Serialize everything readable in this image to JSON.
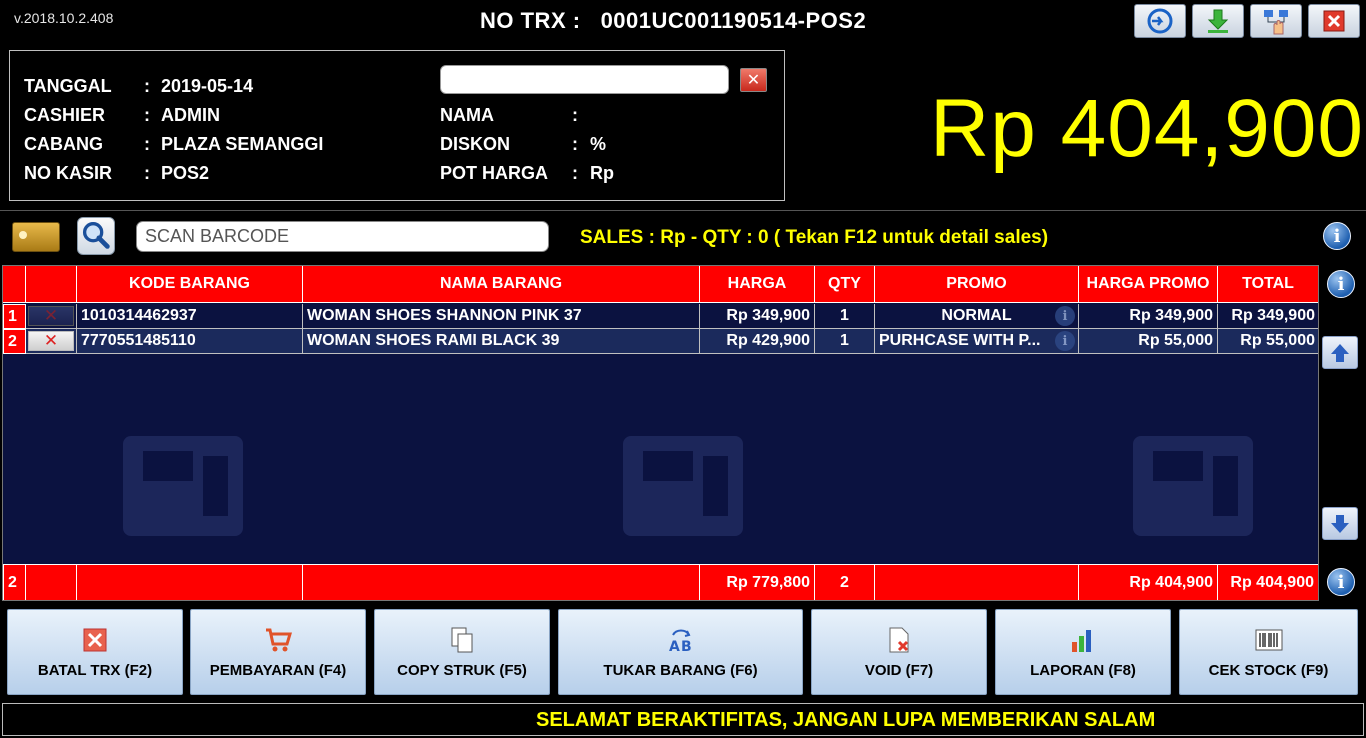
{
  "header": {
    "version": "v.2018.10.2.408",
    "trx_label": "NO TRX :",
    "trx_value": "0001UC001190514-POS2"
  },
  "toolbar": [
    {
      "name": "refresh",
      "icon": "refresh-icon"
    },
    {
      "name": "download",
      "icon": "download-icon"
    },
    {
      "name": "network",
      "icon": "network-hand-icon"
    },
    {
      "name": "close",
      "icon": "close-icon"
    }
  ],
  "info": {
    "tanggal_label": "TANGGAL",
    "tanggal_value": "2019-05-14",
    "cashier_label": "CASHIER",
    "cashier_value": "ADMIN",
    "cabang_label": "CABANG",
    "cabang_value": "PLAZA SEMANGGI",
    "kasir_label": "NO KASIR",
    "kasir_value": "POS2",
    "nama_label": "NAMA",
    "nama_value": "",
    "diskon_label": "DISKON",
    "diskon_value": "%",
    "pot_label": "POT HARGA",
    "pot_value": "Rp",
    "colon": ":",
    "member_value": ""
  },
  "total": "Rp 404,900",
  "scan": {
    "placeholder": "SCAN BARCODE",
    "sales_info": "SALES : Rp  - QTY : 0 ( Tekan F12 untuk detail sales)"
  },
  "grid": {
    "columns": [
      "",
      "",
      "KODE BARANG",
      "NAMA BARANG",
      "HARGA",
      "QTY",
      "PROMO",
      "HARGA PROMO",
      "TOTAL"
    ],
    "rows": [
      {
        "no": "1",
        "kode": "1010314462937",
        "nama": "WOMAN SHOES SHANNON PINK 37",
        "harga": "Rp 349,900",
        "qty": "1",
        "promo": "NORMAL",
        "harga_promo": "Rp 349,900",
        "total": "Rp 349,900"
      },
      {
        "no": "2",
        "kode": "7770551485110",
        "nama": "WOMAN SHOES RAMI BLACK 39",
        "harga": "Rp 429,900",
        "qty": "1",
        "promo": "PURHCASE WITH P...",
        "harga_promo": "Rp 55,000",
        "total": "Rp 55,000"
      }
    ],
    "footer": {
      "count": "2",
      "harga": "Rp 779,800",
      "qty": "2",
      "harga_promo": "Rp 404,900",
      "total": "Rp 404,900"
    }
  },
  "buttons": [
    {
      "label": "BATAL TRX (F2)",
      "icon": "cancel-icon"
    },
    {
      "label": "PEMBAYARAN (F4)",
      "icon": "cart-icon"
    },
    {
      "label": "COPY STRUK (F5)",
      "icon": "copy-icon"
    },
    {
      "label": "TUKAR BARANG (F6)",
      "icon": "exchange-icon"
    },
    {
      "label": "VOID (F7)",
      "icon": "void-icon"
    },
    {
      "label": "LAPORAN (F8)",
      "icon": "report-chart-icon"
    },
    {
      "label": "CEK STOCK (F9)",
      "icon": "barcode-icon"
    }
  ],
  "marquee": "SELAMAT BERAKTIFITAS, JANGAN LUPA MEMBERIKAN SALAM",
  "colors": {
    "accent_yellow": "#ffff00",
    "grid_red": "#ff0000",
    "grid_bg": "#0b1240"
  }
}
